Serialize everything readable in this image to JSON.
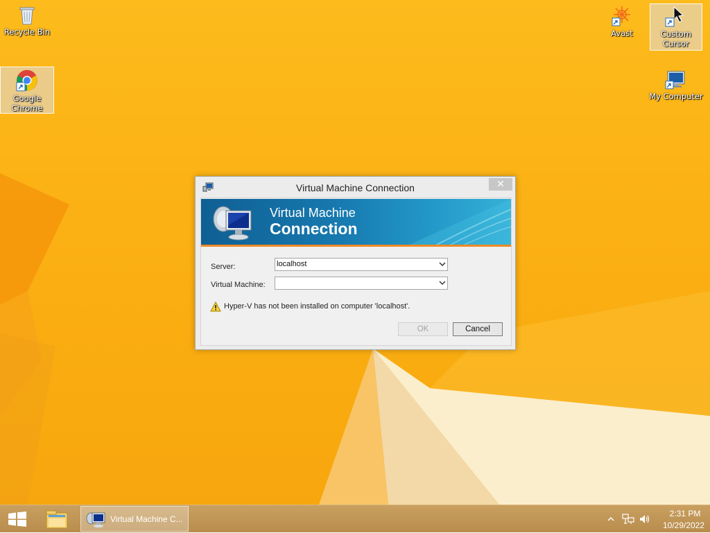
{
  "desktop": {
    "background_color": "#fbb013",
    "icons": [
      {
        "label": "Recycle Bin",
        "icon": "recycle-bin-icon"
      },
      {
        "label": "Google Chrome",
        "icon": "chrome-icon",
        "selected": true
      },
      {
        "label": "Avast",
        "icon": "avast-icon"
      },
      {
        "label": "Custom Cursor",
        "icon": "custom-cursor-icon",
        "selected": true
      },
      {
        "label": "My Computer",
        "icon": "my-computer-icon"
      }
    ]
  },
  "dialog": {
    "title": "Virtual Machine Connection",
    "close_glyph": "✕",
    "banner": {
      "line1": "Virtual Machine",
      "line2": "Connection",
      "accent_color": "#f08a24"
    },
    "server_label": "Server:",
    "server_value": "localhost",
    "vm_label": "Virtual Machine:",
    "vm_value": "",
    "warning": "Hyper-V has not been installed on computer 'localhost'.",
    "ok_label": "OK",
    "ok_enabled": false,
    "cancel_label": "Cancel"
  },
  "taskbar": {
    "start_icon": "windows-logo-icon",
    "pinned": [
      {
        "icon": "file-explorer-icon"
      }
    ],
    "active_task": {
      "label": "Virtual Machine C...",
      "icon": "vmconnect-icon"
    },
    "tray": {
      "icons": [
        "show-hidden-icons-chevron",
        "network-icon",
        "volume-icon"
      ],
      "time": "2:31 PM",
      "date": "10/29/2022"
    }
  }
}
